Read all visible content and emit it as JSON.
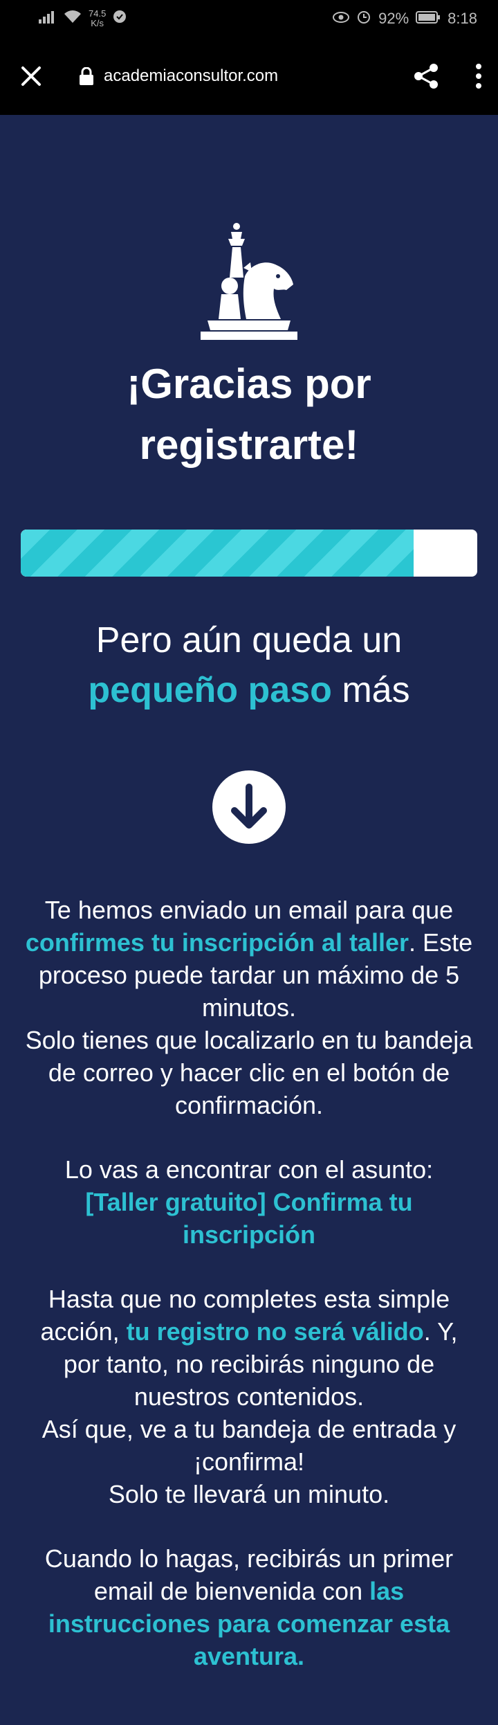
{
  "status_bar": {
    "net_speed_value": "74.5",
    "net_speed_unit": "K/s",
    "battery": "92%",
    "time": "8:18"
  },
  "browser": {
    "url": "academiaconsultor.com"
  },
  "main": {
    "title_line1": "¡Gracias por",
    "title_line2": "registrarte!",
    "progress_value": 0.86,
    "subheading_line1": "Pero aún queda un",
    "subheading_accent": "pequeño paso",
    "subheading_suffix": " más"
  },
  "body": {
    "p1_text1": "Te hemos enviado un email para que ",
    "p1_accent": "confirmes tu inscripción al taller",
    "p1_text2": ". Este proceso puede tardar un máximo de 5 minutos.",
    "p1_text3": "Solo tienes que localizarlo en tu bandeja de correo y hacer clic en el botón de confirmación.",
    "p2_text": "Lo vas a encontrar con el asunto:",
    "p2_accent": "[Taller gratuito] Confirma tu inscripción",
    "p3_text1": "Hasta que no completes esta simple acción, ",
    "p3_accent": "tu registro no será válido",
    "p3_text2": ". Y, por tanto, no recibirás ninguno de nuestros contenidos.",
    "p3_text3": "Así que, ve a tu bandeja de entrada y ¡confirma!",
    "p3_text4": "Solo te llevará un minuto.",
    "p4_text": "Cuando lo hagas, recibirás un primer email de bienvenida con ",
    "p4_accent": "las instrucciones para comenzar esta aventura."
  }
}
